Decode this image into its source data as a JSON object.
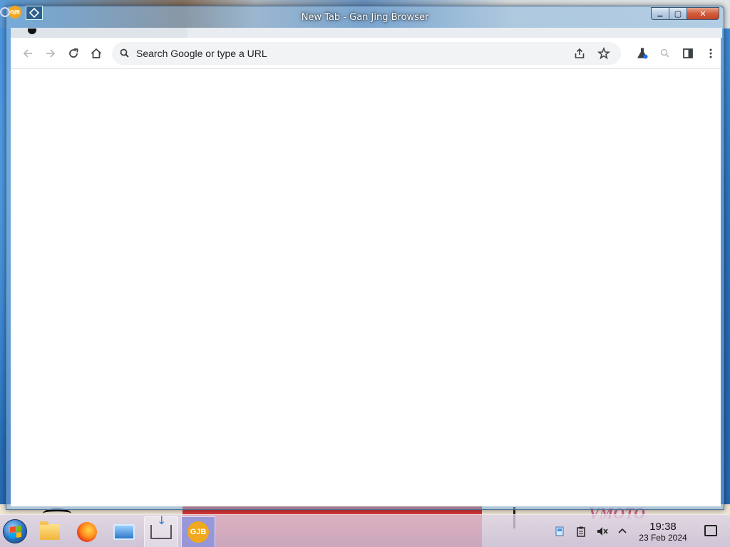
{
  "window": {
    "title": "New Tab - Gan Jing Browser",
    "controls": {
      "minimize": "▁",
      "maximize": "▢",
      "close": "✕"
    }
  },
  "toolbar": {
    "back_icon": "arrow-left-icon",
    "forward_icon": "arrow-right-icon",
    "reload_icon": "reload-icon",
    "home_icon": "home-icon",
    "share_icon": "share-icon",
    "bookmark_icon": "star-icon",
    "extension_icon": "flask-icon",
    "zoom_icon": "search-icon",
    "sidepanel_icon": "side-panel-icon",
    "menu_icon": "kebab-menu-icon"
  },
  "omnibox": {
    "placeholder": "Search Google or type a URL",
    "value": ""
  },
  "desktop": {
    "icons": [
      "GJB",
      "app-icon"
    ],
    "watermark": "VMOTO"
  },
  "taskbar": {
    "items": [
      {
        "name": "file-explorer",
        "active": false
      },
      {
        "name": "firefox",
        "active": false
      },
      {
        "name": "remote-desktop",
        "active": false
      },
      {
        "name": "downloads",
        "active": true
      },
      {
        "name": "gan-jing-browser",
        "label": "GJB",
        "active": true
      }
    ],
    "tray": [
      "network-icon",
      "clipboard-icon",
      "volume-muted-icon",
      "chevron-up-icon"
    ],
    "clock": {
      "time": "19:38",
      "date": "23 Feb 2024"
    }
  },
  "colors": {
    "accent": "#1a73e8",
    "omnibox_bg": "#f1f3f4",
    "close_button": "#c2442a",
    "gjb_brand": "#f0a91e"
  }
}
